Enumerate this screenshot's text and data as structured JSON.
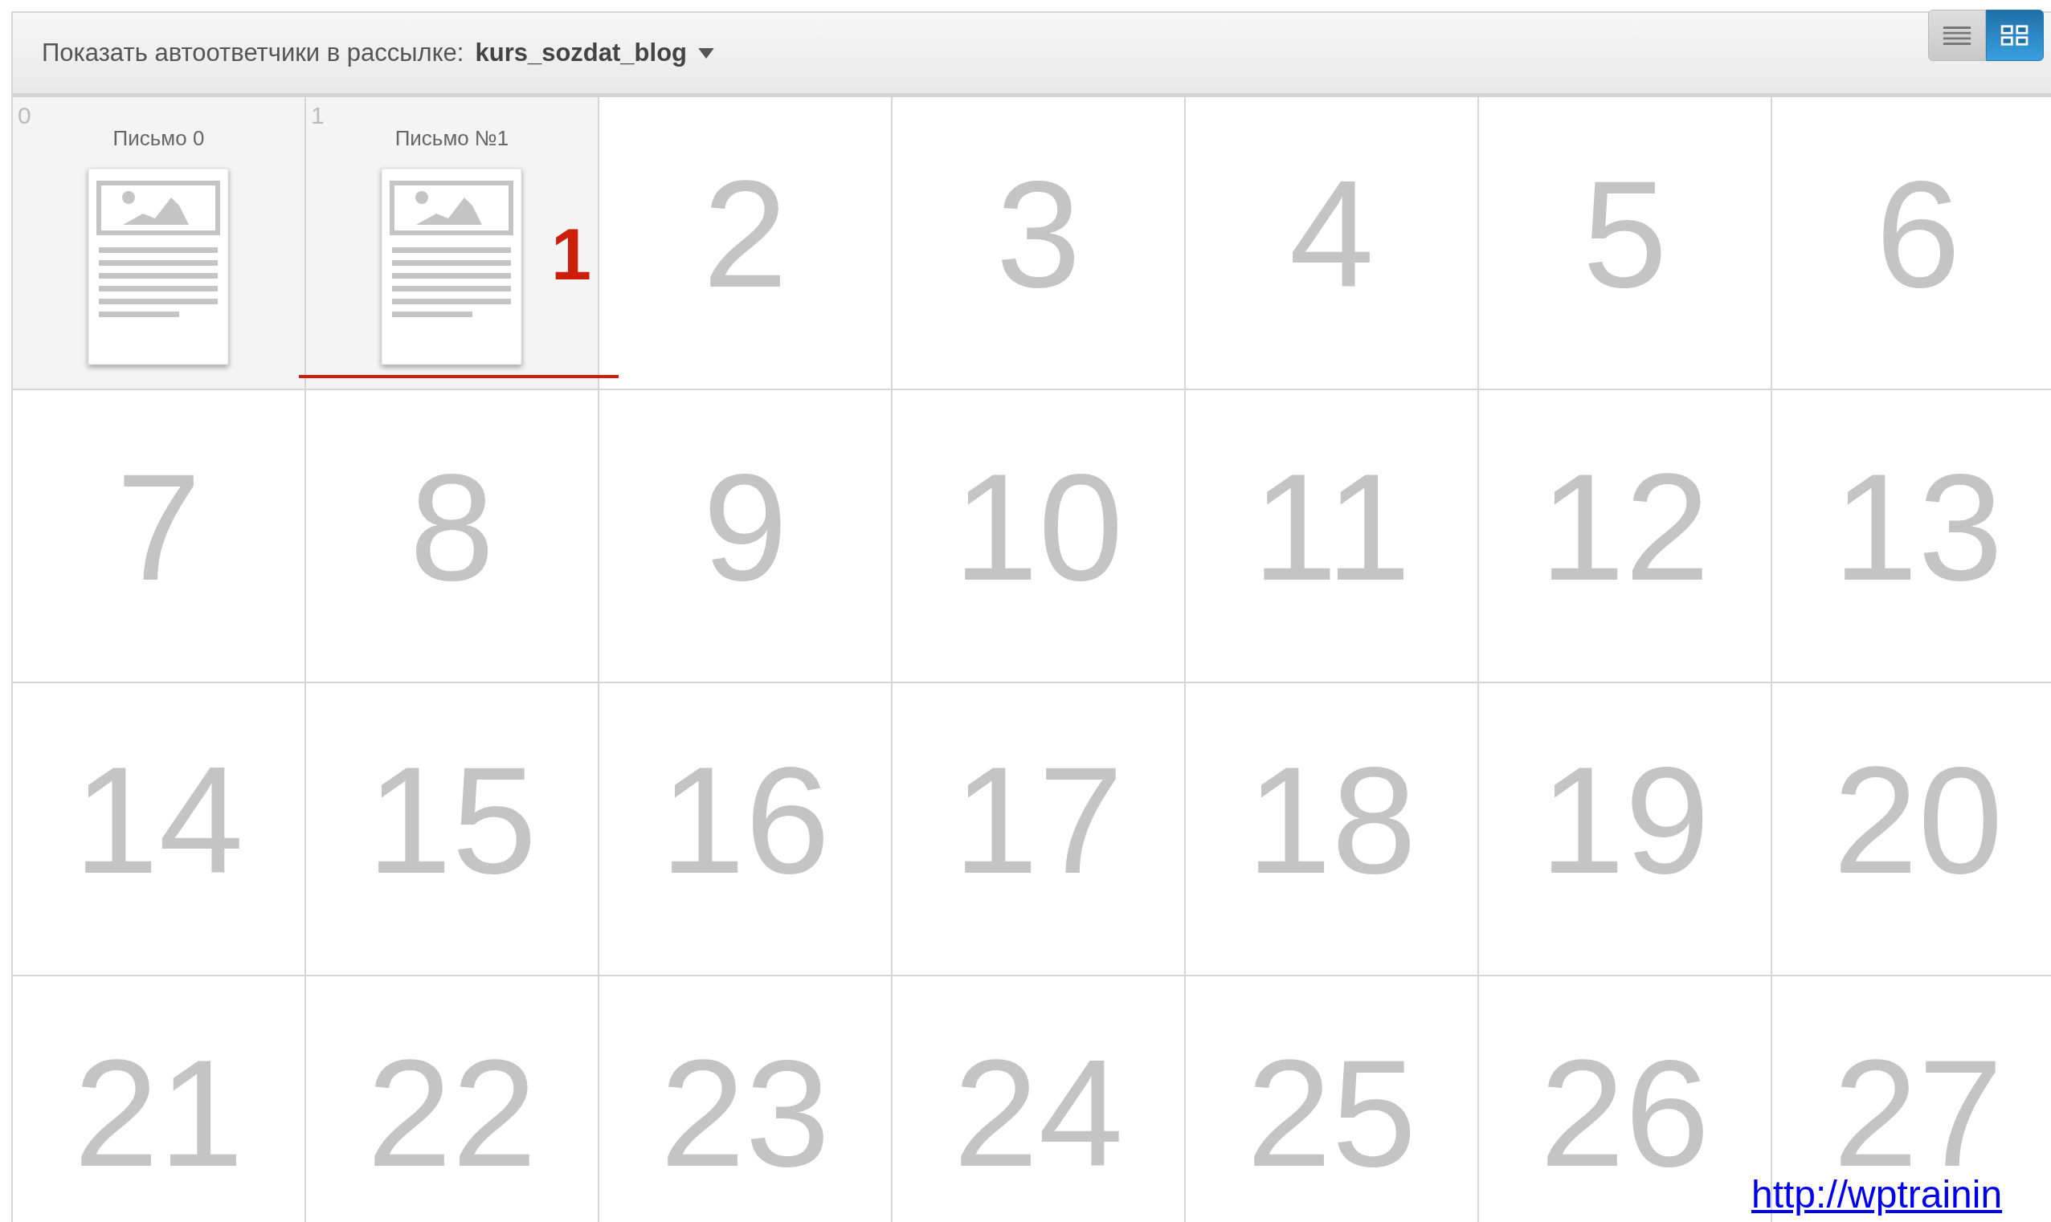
{
  "toolbar": {
    "label": "Показать автоответчики в рассылке:",
    "list_name": "kurs_sozdat_blog",
    "views": [
      {
        "kind": "list",
        "selected": false
      },
      {
        "kind": "grid",
        "selected": true
      }
    ]
  },
  "cells": [
    {
      "kind": "letter",
      "number": "0",
      "title": "Письмо 0"
    },
    {
      "kind": "letter",
      "number": "1",
      "title": "Письмо №1"
    },
    {
      "kind": "empty",
      "number": "2"
    },
    {
      "kind": "empty",
      "number": "3"
    },
    {
      "kind": "empty",
      "number": "4"
    },
    {
      "kind": "empty",
      "number": "5"
    },
    {
      "kind": "empty",
      "number": "6"
    },
    {
      "kind": "empty",
      "number": "7"
    },
    {
      "kind": "empty",
      "number": "8"
    },
    {
      "kind": "empty",
      "number": "9"
    },
    {
      "kind": "empty",
      "number": "10"
    },
    {
      "kind": "empty",
      "number": "11"
    },
    {
      "kind": "empty",
      "number": "12"
    },
    {
      "kind": "empty",
      "number": "13"
    },
    {
      "kind": "empty",
      "number": "14"
    },
    {
      "kind": "empty",
      "number": "15"
    },
    {
      "kind": "empty",
      "number": "16"
    },
    {
      "kind": "empty",
      "number": "17"
    },
    {
      "kind": "empty",
      "number": "18"
    },
    {
      "kind": "empty",
      "number": "19"
    },
    {
      "kind": "empty",
      "number": "20"
    },
    {
      "kind": "empty",
      "number": "21"
    },
    {
      "kind": "empty",
      "number": "22"
    },
    {
      "kind": "empty",
      "number": "23"
    },
    {
      "kind": "empty",
      "number": "24"
    },
    {
      "kind": "empty",
      "number": "25"
    },
    {
      "kind": "empty",
      "number": "26"
    },
    {
      "kind": "empty",
      "number": "27"
    }
  ],
  "annotation": {
    "label": "1"
  },
  "link": "http://wptrainin"
}
